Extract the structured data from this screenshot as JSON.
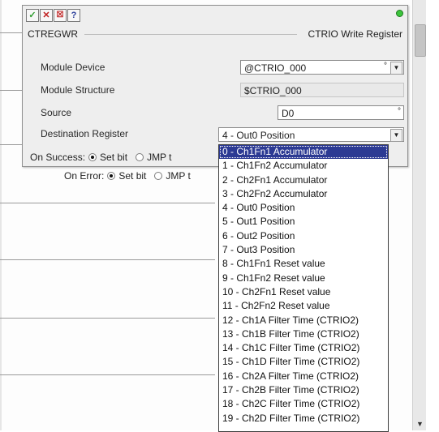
{
  "dialog": {
    "buttons": {
      "ok_icon": "check-icon",
      "cancel_icon": "x-icon",
      "options_icon": "crossed-box-icon",
      "help_label": "?"
    },
    "instruction_name": "CTREGWR",
    "instruction_title": "CTRIO Write Register",
    "module_device": {
      "label": "Module Device",
      "value": "@CTRIO_000"
    },
    "module_structure": {
      "label": "Module Structure",
      "value": "$CTRIO_000"
    },
    "source": {
      "label": "Source",
      "value": "D0"
    },
    "destination_register": {
      "label": "Destination Register",
      "value": "4 - Out0 Position"
    },
    "on_success": {
      "label": "On Success:",
      "opt1": "Set bit",
      "opt2": "JMP t"
    },
    "on_error": {
      "label": "On Error:",
      "opt1": "Set bit",
      "opt2": "JMP t"
    }
  },
  "dropdown_options": [
    "0 - Ch1Fn1 Accumulator",
    "1 - Ch1Fn2 Accumulator",
    "2 - Ch2Fn1 Accumulator",
    "3 - Ch2Fn2 Accumulator",
    "4 - Out0 Position",
    "5 - Out1 Position",
    "6 - Out2 Position",
    "7 - Out3 Position",
    "8 - Ch1Fn1 Reset value",
    "9 - Ch1Fn2 Reset value",
    "10 - Ch2Fn1 Reset value",
    "11 - Ch2Fn2 Reset value",
    "12 - Ch1A Filter Time (CTRIO2)",
    "13 - Ch1B Filter Time (CTRIO2)",
    "14 - Ch1C Filter Time (CTRIO2)",
    "15 - Ch1D Filter Time (CTRIO2)",
    "16 - Ch2A Filter Time (CTRIO2)",
    "17 - Ch2B Filter Time (CTRIO2)",
    "18 - Ch2C Filter Time (CTRIO2)",
    "19 - Ch2D Filter Time (CTRIO2)"
  ],
  "highlighted_option_index": 0,
  "colors": {
    "selection": "#2c3a93",
    "status_ok": "#3cc43c"
  }
}
